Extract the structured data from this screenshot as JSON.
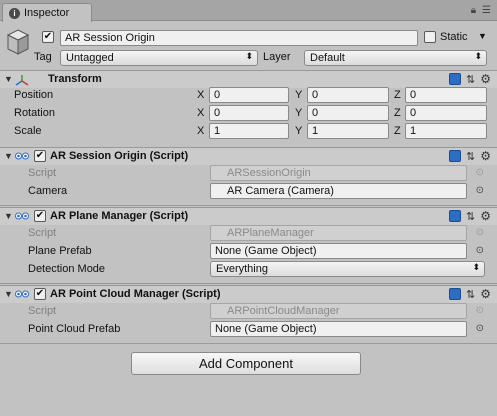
{
  "tab": {
    "label": "Inspector"
  },
  "header": {
    "object_name": "AR Session Origin",
    "static_label": "Static",
    "tag_label": "Tag",
    "tag_value": "Untagged",
    "layer_label": "Layer",
    "layer_value": "Default"
  },
  "transform": {
    "title": "Transform",
    "rows": [
      {
        "label": "Position",
        "x": "0",
        "y": "0",
        "z": "0"
      },
      {
        "label": "Rotation",
        "x": "0",
        "y": "0",
        "z": "0"
      },
      {
        "label": "Scale",
        "x": "1",
        "y": "1",
        "z": "1"
      }
    ],
    "axis": {
      "x": "X",
      "y": "Y",
      "z": "Z"
    }
  },
  "components": [
    {
      "title": "AR Session Origin (Script)",
      "script_label": "Script",
      "script_value": "ARSessionOrigin",
      "field_label": "Camera",
      "field_value": "AR Camera (Camera)"
    },
    {
      "title": "AR Plane Manager (Script)",
      "script_label": "Script",
      "script_value": "ARPlaneManager",
      "field_label": "Plane Prefab",
      "field_value": "None (Game Object)",
      "mode_label": "Detection Mode",
      "mode_value": "Everything"
    },
    {
      "title": "AR Point Cloud Manager (Script)",
      "script_label": "Script",
      "script_value": "ARPointCloudManager",
      "field_label": "Point Cloud Prefab",
      "field_value": "None (Game Object)"
    }
  ],
  "add_component": "Add Component",
  "colors": {
    "accent": "#2d6ec4",
    "panel": "#c2c2c2"
  }
}
